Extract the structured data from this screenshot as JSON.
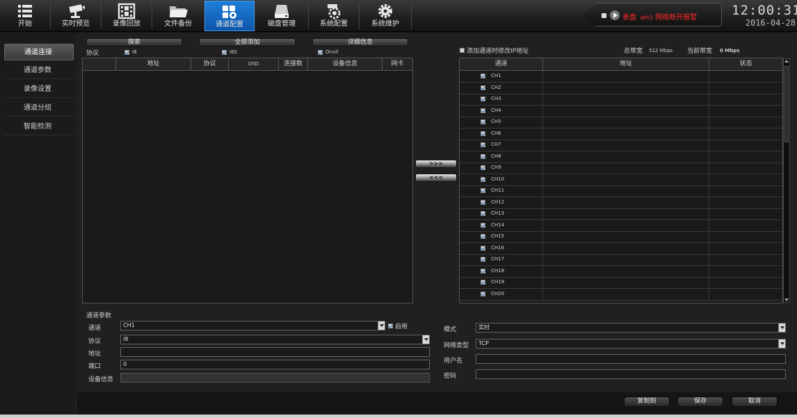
{
  "toolbar": {
    "items": [
      {
        "label": "开始",
        "icon": "menu-grid-icon"
      },
      {
        "label": "实时预览",
        "icon": "cctv-camera-icon"
      },
      {
        "label": "录像回放",
        "icon": "film-icon"
      },
      {
        "label": "文件备份",
        "icon": "folder-icon"
      },
      {
        "label": "通道配置",
        "icon": "channel-config-icon"
      },
      {
        "label": "磁盘管理",
        "icon": "disk-icon"
      },
      {
        "label": "系统配置",
        "icon": "camera-gear-icon"
      },
      {
        "label": "系统维护",
        "icon": "gear-icon"
      }
    ],
    "active_index": 4
  },
  "alarm": {
    "prefix": "表盘",
    "port": "eth1",
    "message": "网络断开报警"
  },
  "clock": {
    "time": "12:00:31",
    "date": "2016-04-28"
  },
  "sidebar": {
    "items": [
      {
        "label": "通道连接"
      },
      {
        "label": "通道参数"
      },
      {
        "label": "录像设置"
      },
      {
        "label": "通道分组"
      },
      {
        "label": "智能检测"
      }
    ],
    "active_index": 0
  },
  "search_panel": {
    "search_btn": "搜索",
    "add_all_btn": "全部添加",
    "details_btn": "详细信息",
    "protocol_label": "协议",
    "protocols": [
      {
        "name": "I8",
        "checked": true
      },
      {
        "name": "I8S",
        "checked": true
      },
      {
        "name": "Onvif",
        "checked": true
      }
    ],
    "columns": [
      "地址",
      "协议",
      "OSD",
      "连接数",
      "设备信息",
      "网卡"
    ]
  },
  "transfer": {
    "add": ">>>",
    "remove": "<<<"
  },
  "channel_panel": {
    "modify_ip_label": "添加通道时修改IP地址",
    "total_bw_label": "总带宽",
    "total_bw_value": "512 Mbps",
    "current_bw_label": "当前带宽",
    "current_bw_value": "0 Mbps",
    "columns": [
      "通道",
      "地址",
      "状态"
    ],
    "channels": [
      "CH1",
      "CH2",
      "CH3",
      "CH4",
      "CH5",
      "CH6",
      "CH7",
      "CH8",
      "CH9",
      "CH10",
      "CH11",
      "CH12",
      "CH13",
      "CH14",
      "CH15",
      "CH16",
      "CH17",
      "CH18",
      "CH19",
      "CH20"
    ]
  },
  "params": {
    "section_title": "通道参数",
    "channel_label": "通道",
    "channel_value": "CH1",
    "enable_label": "启用",
    "protocol_label": "协议",
    "protocol_value": "I8",
    "address_label": "地址",
    "address_value": "",
    "port_label": "端口",
    "port_value": "0",
    "device_info_label": "设备信息",
    "device_info_value": "",
    "mode_label": "模式",
    "mode_value": "实时",
    "net_type_label": "网络类型",
    "net_type_value": "TCP",
    "username_label": "用户名",
    "username_value": "",
    "password_label": "密码",
    "password_value": ""
  },
  "footer": {
    "copy_btn": "复制到",
    "save_btn": "保存",
    "cancel_btn": "取消"
  }
}
